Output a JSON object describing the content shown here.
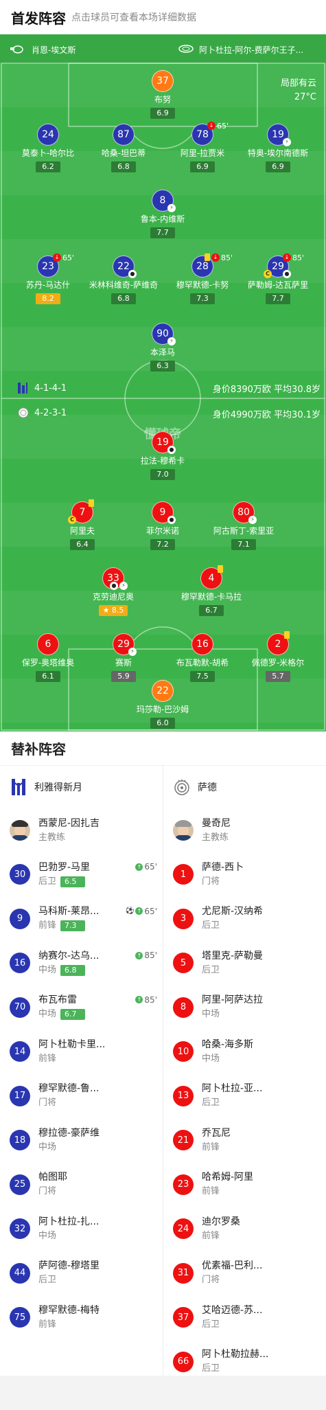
{
  "header": {
    "title": "首发阵容",
    "subtitle": "点击球员可查看本场详细数据"
  },
  "field": {
    "referee": "肖恩-埃文斯",
    "stadium": "阿卜杜拉-阿尔-费萨尔王子...",
    "weather": "局部有云",
    "temperature": "27°C",
    "watermark": "懂球帝",
    "home_formation": "4-1-4-1",
    "home_value": "身价8390万欧 平均30.8岁",
    "away_formation": "4-2-3-1",
    "away_value": "身价4990万欧 平均30.1岁"
  },
  "home_players": [
    {
      "num": "37",
      "name": "布努",
      "rating": "6.9",
      "color": "orange"
    },
    {
      "num": "24",
      "name": "莫泰卜-哈尔比",
      "rating": "6.2"
    },
    {
      "num": "87",
      "name": "哈桑-坦巴蒂",
      "rating": "6.8"
    },
    {
      "num": "78",
      "name": "阿里-拉贾米",
      "rating": "6.9",
      "sub": "65'"
    },
    {
      "num": "19",
      "name": "特奥-埃尔南德斯",
      "rating": "6.9"
    },
    {
      "num": "8",
      "name": "鲁本-内维斯",
      "rating": "7.7"
    },
    {
      "num": "23",
      "name": "苏丹-马达什",
      "rating": "8.2",
      "sub": "65'"
    },
    {
      "num": "22",
      "name": "米林科维奇-萨维奇",
      "rating": "6.8"
    },
    {
      "num": "28",
      "name": "穆罕默德-卡努",
      "rating": "7.3",
      "sub": "85'"
    },
    {
      "num": "29",
      "name": "萨勒姆-达瓦萨里",
      "rating": "7.7",
      "sub": "85'"
    },
    {
      "num": "90",
      "name": "本泽马",
      "rating": "6.3"
    }
  ],
  "away_players": [
    {
      "num": "19",
      "name": "拉法-穆希卡",
      "rating": "7.0"
    },
    {
      "num": "7",
      "name": "阿里夫",
      "rating": "6.4"
    },
    {
      "num": "9",
      "name": "菲尔米诺",
      "rating": "7.2"
    },
    {
      "num": "80",
      "name": "阿古斯丁-索里亚",
      "rating": "7.1"
    },
    {
      "num": "33",
      "name": "克劳迪尼奥",
      "rating": "8.5"
    },
    {
      "num": "4",
      "name": "穆罕默德-卡马拉",
      "rating": "6.7"
    },
    {
      "num": "6",
      "name": "保罗-奥塔维奥",
      "rating": "6.1"
    },
    {
      "num": "29",
      "name": "赛斯",
      "rating": "5.9"
    },
    {
      "num": "16",
      "name": "布瓦勒默-胡希",
      "rating": "7.5"
    },
    {
      "num": "2",
      "name": "佩德罗-米格尔",
      "rating": "5.7"
    },
    {
      "num": "22",
      "name": "玛莎勒-巴沙姆",
      "rating": "6.0"
    }
  ],
  "subs": {
    "title": "替补阵容",
    "home": {
      "team": "利雅得新月",
      "coach": "西蒙尼-因扎吉",
      "coach_role": "主教练",
      "players": [
        {
          "num": "30",
          "name": "巴勃罗-马里",
          "pos": "后卫",
          "rating": "6.5",
          "in": "65'"
        },
        {
          "num": "9",
          "name": "马科斯-莱昂...",
          "pos": "前锋",
          "rating": "7.3",
          "in": "65'"
        },
        {
          "num": "16",
          "name": "纳赛尔-达乌...",
          "pos": "中场",
          "rating": "6.8",
          "in": "85'"
        },
        {
          "num": "70",
          "name": "布瓦布雷",
          "pos": "中场",
          "rating": "6.7",
          "in": "85'"
        },
        {
          "num": "14",
          "name": "阿卜杜勒卡里...",
          "pos": "前锋"
        },
        {
          "num": "17",
          "name": "穆罕默德-鲁...",
          "pos": "门将"
        },
        {
          "num": "18",
          "name": "穆拉德-豪萨维",
          "pos": "中场"
        },
        {
          "num": "25",
          "name": "帕图耶",
          "pos": "门将"
        },
        {
          "num": "32",
          "name": "阿卜杜拉-扎...",
          "pos": "中场"
        },
        {
          "num": "44",
          "name": "萨阿德-穆塔里",
          "pos": "后卫"
        },
        {
          "num": "75",
          "name": "穆罕默德-梅特",
          "pos": "前锋"
        }
      ]
    },
    "away": {
      "team": "萨德",
      "coach": "曼奇尼",
      "coach_role": "主教练",
      "players": [
        {
          "num": "1",
          "name": "萨德-西卜",
          "pos": "门将"
        },
        {
          "num": "3",
          "name": "尤尼斯-汉纳希",
          "pos": "后卫"
        },
        {
          "num": "5",
          "name": "塔里克-萨勒曼",
          "pos": "后卫"
        },
        {
          "num": "8",
          "name": "阿里-阿萨达拉",
          "pos": "中场"
        },
        {
          "num": "10",
          "name": "哈桑-海多斯",
          "pos": "中场"
        },
        {
          "num": "13",
          "name": "阿卜杜拉-亚...",
          "pos": "后卫"
        },
        {
          "num": "21",
          "name": "乔瓦尼",
          "pos": "前锋"
        },
        {
          "num": "23",
          "name": "哈希姆-阿里",
          "pos": "前锋"
        },
        {
          "num": "24",
          "name": "迪尔罗桑",
          "pos": "前锋"
        },
        {
          "num": "31",
          "name": "优素福-巴利...",
          "pos": "门将"
        },
        {
          "num": "37",
          "name": "艾哈迈德-苏...",
          "pos": "后卫"
        },
        {
          "num": "66",
          "name": "阿卜杜勒拉赫...",
          "pos": "后卫"
        }
      ]
    }
  }
}
